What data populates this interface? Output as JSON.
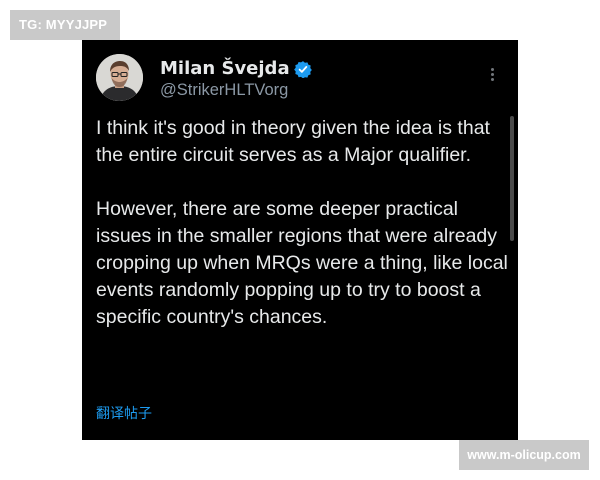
{
  "watermark_top": "TG: MYYJJPP",
  "watermark_bottom": "www.m-olicup.com",
  "tweet": {
    "author_name": "Milan Švejda",
    "handle": "@StrikerHLTVorg",
    "verified": true,
    "body_paragraphs": [
      "I think it's good in theory given the idea is that the entire circuit serves as a Major qualifier.",
      "However, there are some deeper practical issues in the smaller regions that were already cropping up when MRQs were a thing, like local events randomly popping up to try to boost a specific country's chances."
    ],
    "translate_link": "翻译帖子"
  },
  "icons": {
    "verified": "verified-badge-icon",
    "more": "more-options-icon"
  },
  "colors": {
    "background": "#000000",
    "text": "#e7e9ea",
    "secondary_text": "#8b98a5",
    "accent": "#1d9bf0"
  }
}
